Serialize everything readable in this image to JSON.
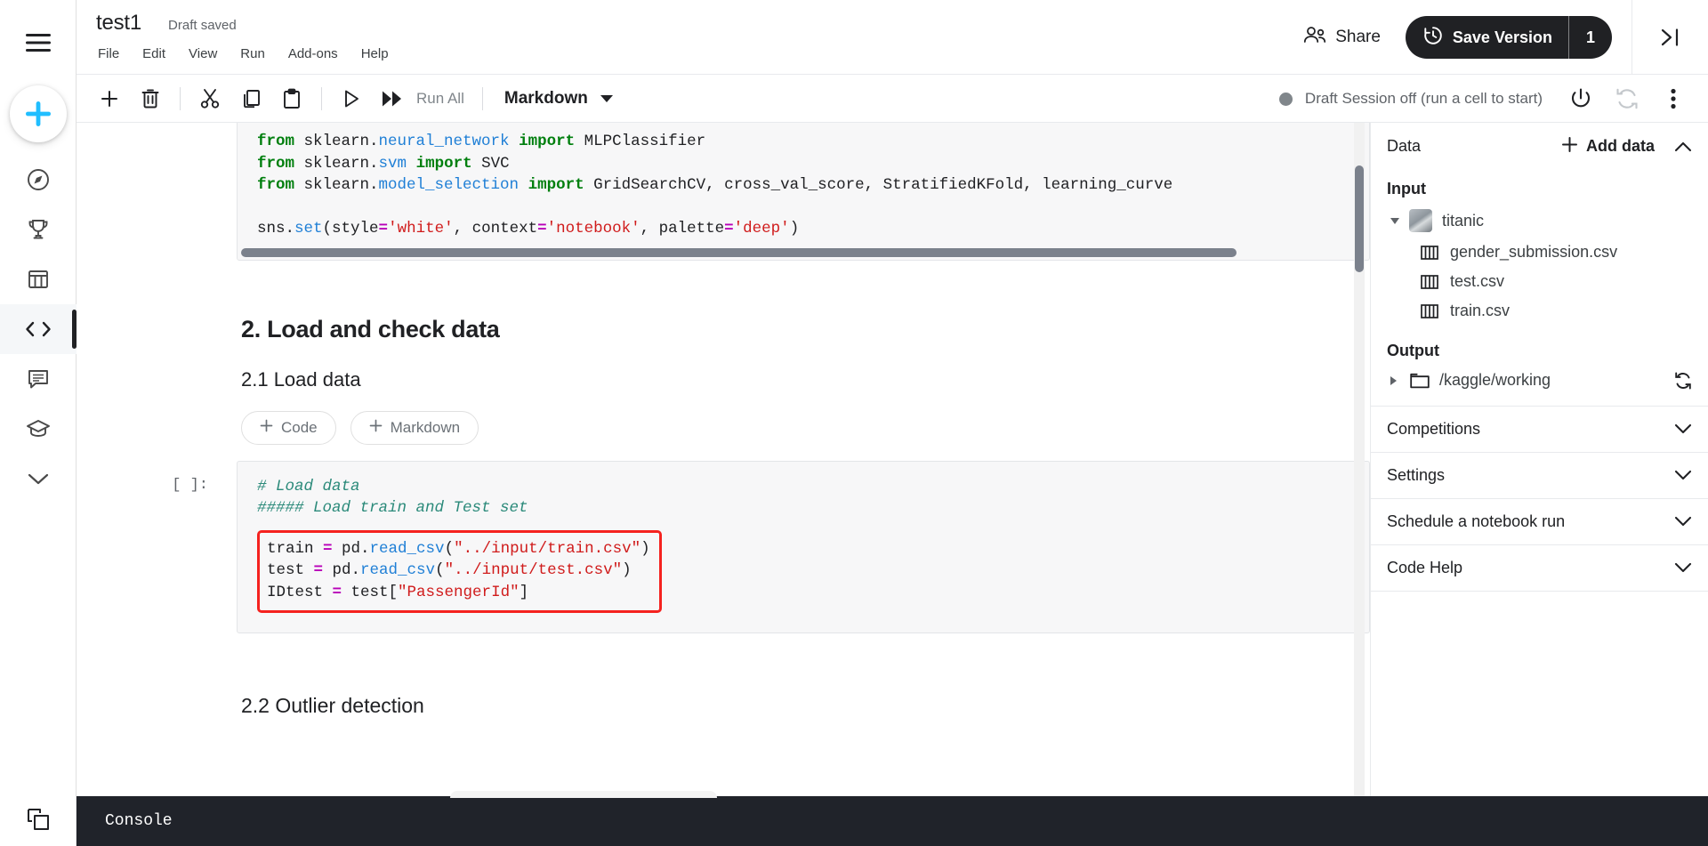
{
  "rail": {
    "items": [
      {
        "name": "hamburger-menu-icon",
        "label": "Menu"
      },
      {
        "name": "create-button",
        "label": "Create"
      },
      {
        "name": "sidebar-item-explore",
        "label": "Explore"
      },
      {
        "name": "sidebar-item-competitions",
        "label": "Competitions"
      },
      {
        "name": "sidebar-item-datasets",
        "label": "Datasets"
      },
      {
        "name": "sidebar-item-code",
        "label": "Code"
      },
      {
        "name": "sidebar-item-discussions",
        "label": "Discussions"
      },
      {
        "name": "sidebar-item-learn",
        "label": "Learn"
      },
      {
        "name": "sidebar-item-more",
        "label": "More"
      }
    ],
    "bottom_item": {
      "name": "sidebar-item-viewer",
      "label": "Viewer"
    }
  },
  "header": {
    "title": "test1",
    "save_status": "Draft saved",
    "menus": [
      "File",
      "Edit",
      "View",
      "Run",
      "Add-ons",
      "Help"
    ],
    "share_label": "Share",
    "save_version_label": "Save Version",
    "version_count": "1"
  },
  "toolbar": {
    "run_all_label": "Run All",
    "cell_type": "Markdown",
    "session_status": "Draft Session off (run a cell to start)",
    "buttons": [
      "add-cell",
      "delete-cell",
      "cut-cell",
      "copy-cell",
      "paste-cell",
      "run-cell",
      "run-all"
    ]
  },
  "notebook": {
    "top_cell": {
      "lines": [
        "from sklearn.neural_network import MLPClassifier",
        "from sklearn.svm import SVC",
        "from sklearn.model_selection import GridSearchCV, cross_val_score, StratifiedKFold, learning_curve",
        "",
        "sns.set(style='white', context='notebook', palette='deep')"
      ]
    },
    "heading_2": "2. Load and check data",
    "heading_2_1": "2.1 Load data",
    "add_code_label": "Code",
    "add_markdown_label": "Markdown",
    "load_cell": {
      "prompt": "[ ]:",
      "comment_lines": [
        "# Load data",
        "##### Load train and Test set"
      ],
      "highlighted_lines": [
        "train = pd.read_csv(\"../input/train.csv\")",
        "test = pd.read_csv(\"../input/test.csv\")",
        "IDtest = test[\"PassengerId\"]"
      ]
    },
    "heading_2_2": "2.2 Outlier detection"
  },
  "data_panel": {
    "title": "Data",
    "add_data_label": "Add data",
    "input_label": "Input",
    "dataset": "titanic",
    "files": [
      "gender_submission.csv",
      "test.csv",
      "train.csv"
    ],
    "output_label": "Output",
    "output_path": "/kaggle/working",
    "accordions": [
      "Competitions",
      "Settings",
      "Schedule a notebook run",
      "Code Help"
    ]
  },
  "console": {
    "label": "Console"
  },
  "colors": {
    "accent_blue": "#20beff",
    "dark": "#202124",
    "highlight_red": "#f5221f",
    "console_bg": "#20232a"
  }
}
